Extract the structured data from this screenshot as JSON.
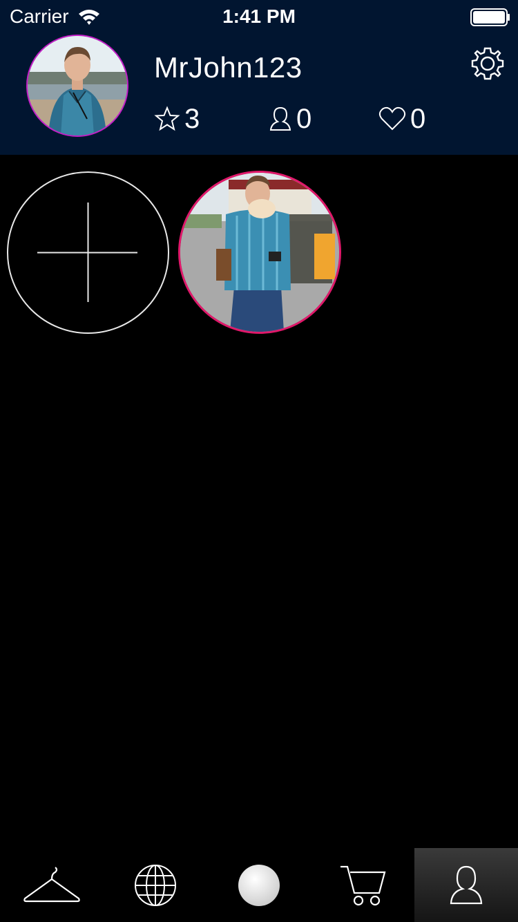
{
  "status_bar": {
    "carrier": "Carrier",
    "time": "1:41 PM",
    "wifi_icon": "wifi-icon",
    "battery_icon": "battery-icon"
  },
  "profile": {
    "username": "MrJohn123",
    "avatar": "avatar-photo",
    "settings_icon": "gear-icon",
    "stats": {
      "stars": "3",
      "followers": "0",
      "likes": "0"
    },
    "accent_color": "#c41cc8",
    "header_color": "#011530"
  },
  "gallery": {
    "add_icon": "plus-icon",
    "photos": [
      {
        "name": "photo-1",
        "border_color": "#e0186a"
      }
    ]
  },
  "tabbar": {
    "tabs": [
      {
        "icon": "hanger-icon",
        "active": false
      },
      {
        "icon": "globe-icon",
        "active": false
      },
      {
        "icon": "ball-icon",
        "active": false
      },
      {
        "icon": "cart-icon",
        "active": false
      },
      {
        "icon": "profile-icon",
        "active": true
      }
    ]
  }
}
